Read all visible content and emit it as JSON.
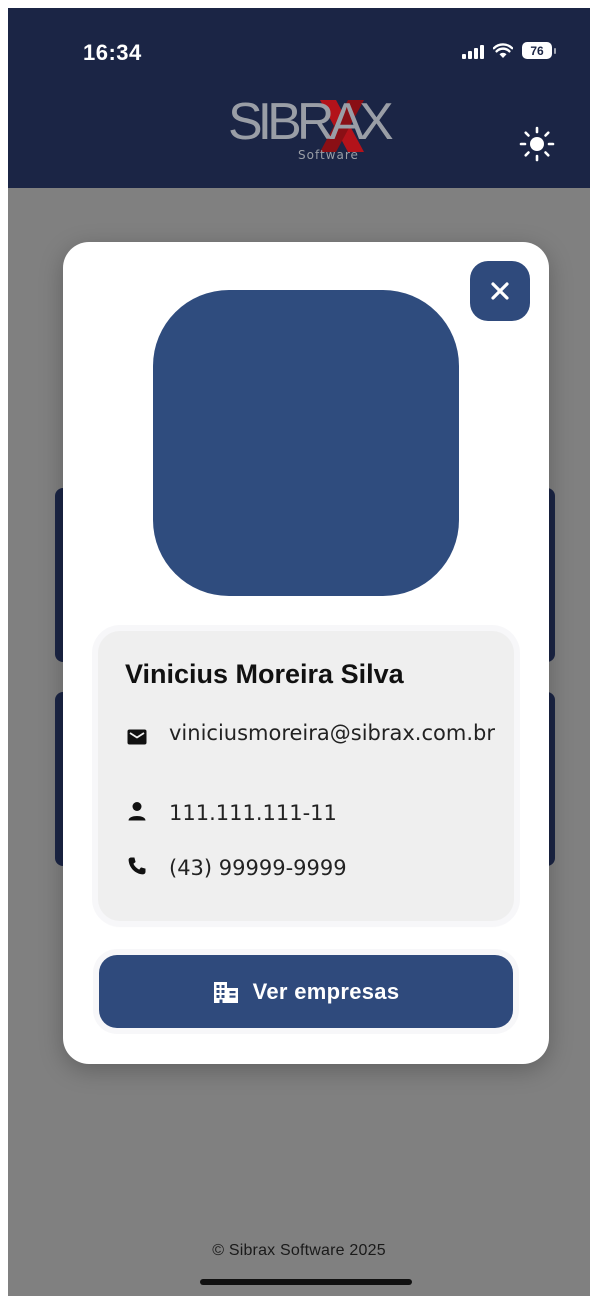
{
  "status_bar": {
    "time": "16:34",
    "battery": "76"
  },
  "header": {
    "logo_text": "SIBRAX",
    "logo_sub": "Software"
  },
  "profile": {
    "name": "Vinicius Moreira Silva",
    "email": "viniciusmoreira@sibrax.com.br",
    "document": "111.111.111-11",
    "phone": "(43) 99999-9999"
  },
  "actions": {
    "see_companies_label": "Ver empresas"
  },
  "footer": {
    "copyright": "© Sibrax Software 2025"
  },
  "colors": {
    "appbar": "#1b2545",
    "primary": "#2f4a7c",
    "overlay": "#808080",
    "logo_accent": "#b3121a"
  },
  "icons": {
    "close": "close-icon",
    "theme": "sun-icon",
    "email": "mail-icon",
    "document": "person-icon",
    "phone": "phone-icon",
    "companies": "building-icon"
  }
}
